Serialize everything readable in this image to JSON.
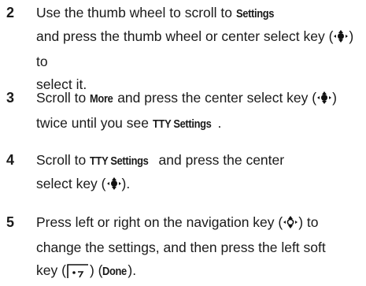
{
  "steps": [
    {
      "number": "2",
      "parts": [
        {
          "t": "Use the thumb wheel to scroll to "
        },
        {
          "ui": "Settings"
        },
        {
          "t": " and press the thumb wheel or center select key ("
        },
        {
          "icon": "center-select-key-icon"
        },
        {
          "t": ") to select it."
        }
      ]
    },
    {
      "number": "3",
      "parts": [
        {
          "t": "Scroll to "
        },
        {
          "ui": "More"
        },
        {
          "t": " and press the center select key ("
        },
        {
          "icon": "center-select-key-icon"
        },
        {
          "t": ") twice until you see "
        },
        {
          "ui": "TTY Settings"
        },
        {
          "t": "."
        }
      ]
    },
    {
      "number": "4",
      "parts": [
        {
          "t": "Scroll to "
        },
        {
          "ui": "TTY Settings"
        },
        {
          "t": " and press the center select key ("
        },
        {
          "icon": "center-select-key-icon"
        },
        {
          "t": ")."
        }
      ]
    },
    {
      "number": "5",
      "parts": [
        {
          "t": "Press left or right on the navigation key ("
        },
        {
          "icon": "navigation-key-icon"
        },
        {
          "t": ") to change the settings, and then press the left soft key ("
        },
        {
          "icon": "left-soft-key-icon"
        },
        {
          "t": ") ("
        },
        {
          "ui": "Done"
        },
        {
          "t": ")."
        }
      ]
    }
  ]
}
